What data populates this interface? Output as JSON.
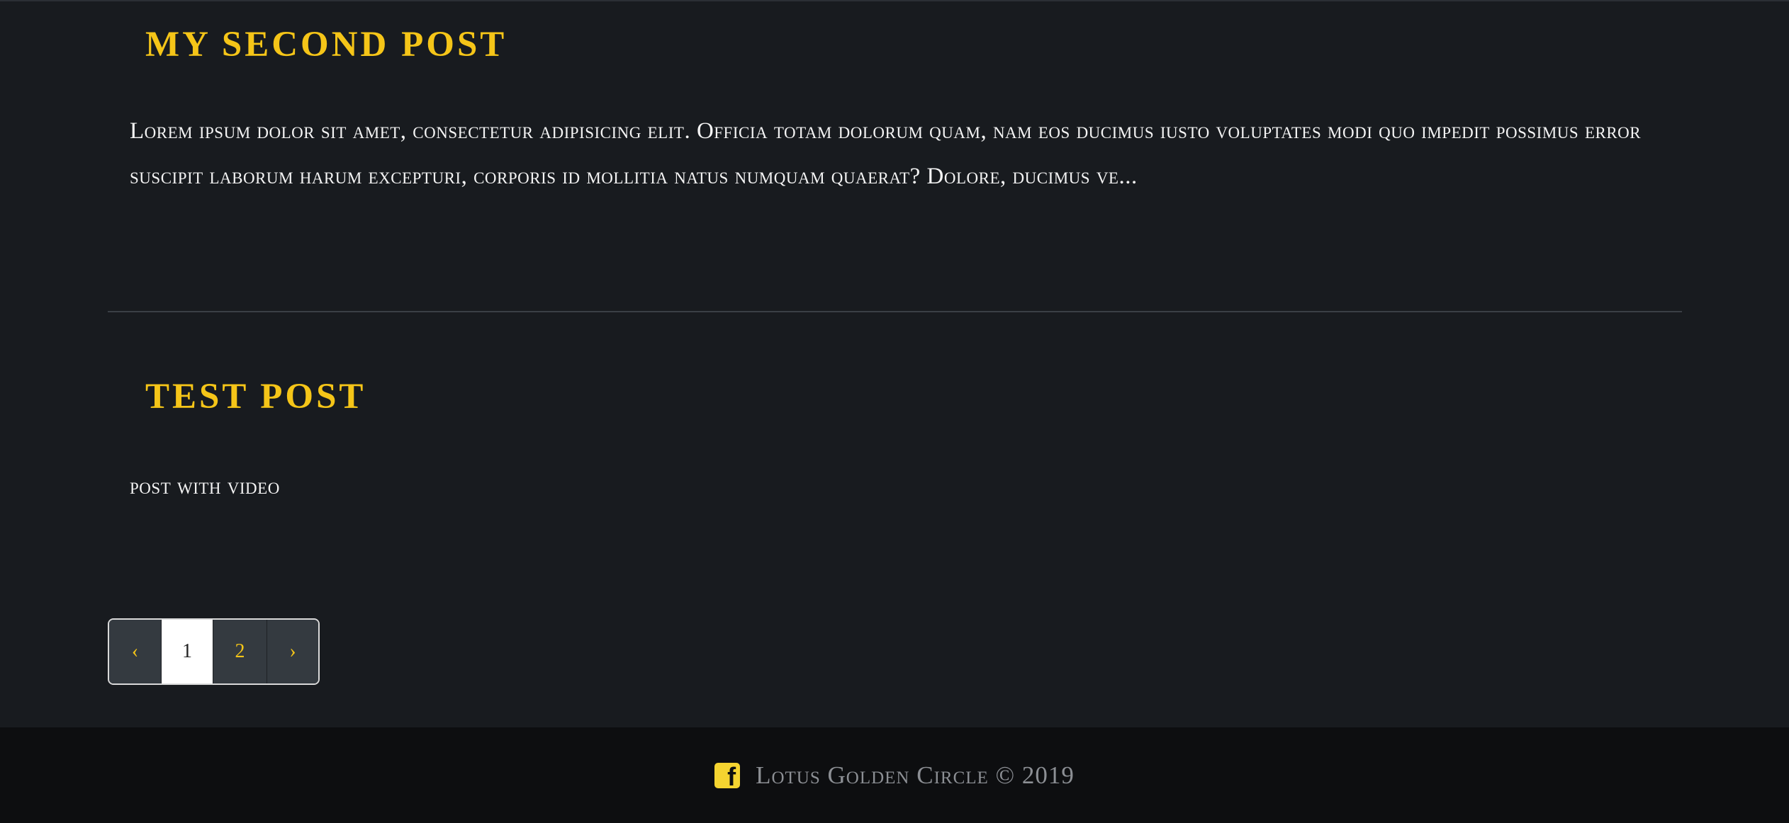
{
  "posts": [
    {
      "title": "My Second Post",
      "excerpt": "Lorem ipsum dolor sit amet, consectetur adipisicing elit. Officia totam dolorum quam, nam eos ducimus iusto voluptates modi quo impedit possimus error suscipit laborum harum excepturi, corporis id mollitia natus numquam quaerat? Dolore, ducimus ve..."
    },
    {
      "title": "Test Post",
      "excerpt": "post with video"
    }
  ],
  "pagination": {
    "prev_label": "‹",
    "pages": [
      "1",
      "2"
    ],
    "current_page": "1",
    "next_label": "›"
  },
  "footer": {
    "icon": "facebook-icon",
    "text": "Lotus Golden Circle © 2019"
  },
  "colors": {
    "background": "#181b1f",
    "accent": "#f5c518",
    "footer_bg": "#0d0e10"
  }
}
